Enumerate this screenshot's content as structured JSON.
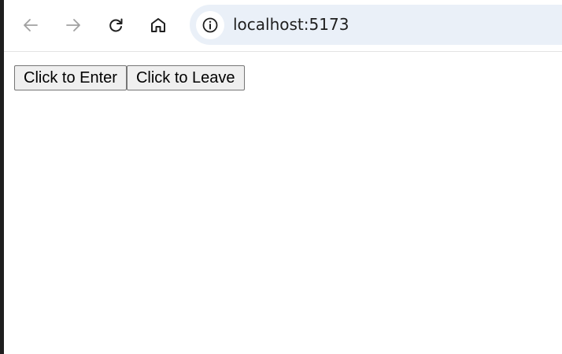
{
  "browser": {
    "address_bar": {
      "url": "localhost:5173"
    },
    "nav_icons": {
      "back": "arrow-left-icon",
      "forward": "arrow-right-icon",
      "reload": "reload-icon",
      "home": "home-icon",
      "site_info": "info-icon"
    }
  },
  "page": {
    "buttons": {
      "enter_label": "Click to Enter",
      "leave_label": "Click to Leave"
    }
  }
}
